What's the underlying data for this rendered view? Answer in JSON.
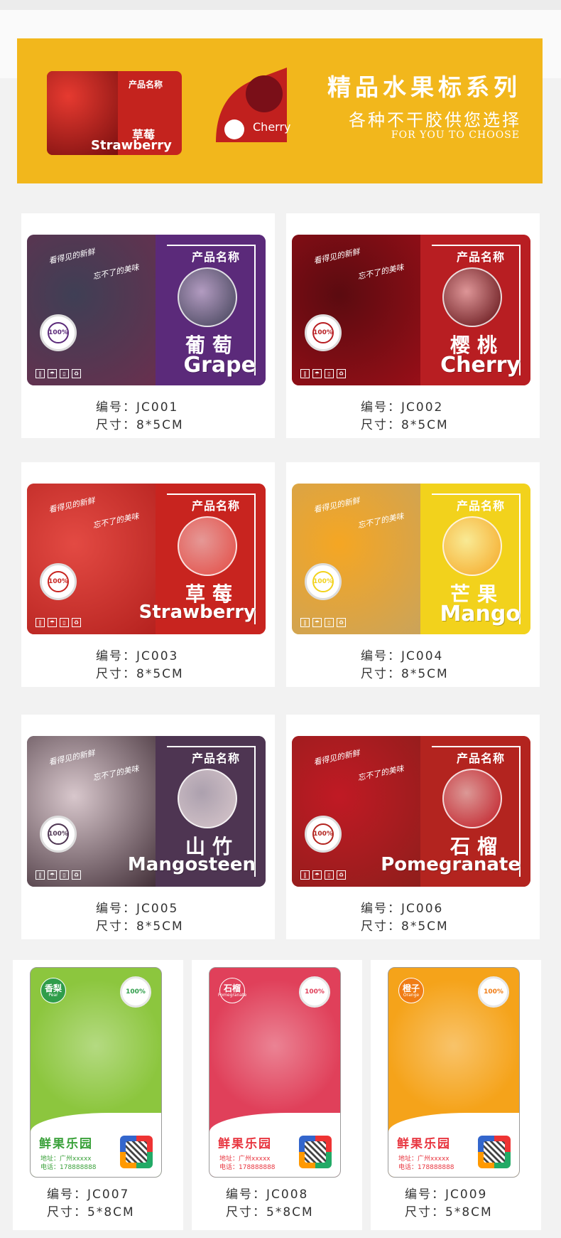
{
  "banner": {
    "title": "精品水果标系列",
    "subtitle": "各种不干胶供您选择",
    "english": "FOR YOU TO CHOOSE",
    "mini1": {
      "label": "产品名称",
      "cn": "草莓",
      "en": "Strawberry"
    },
    "mini2": {
      "en": "Cherry"
    }
  },
  "common": {
    "product_label": "产品名称",
    "badge": "100%",
    "slogan1": "看得见的新鲜",
    "slogan2": "忘不了的美味",
    "code_prefix": "编号：",
    "size_prefix": "尺寸："
  },
  "labels": [
    {
      "cn": "葡萄",
      "en": "Grape",
      "code": "JC001",
      "size": "8*5CM",
      "panel": "#5b2a7a",
      "photo": "#6a2f4e",
      "circle": "#3f3f55"
    },
    {
      "cn": "樱桃",
      "en": "Cherry",
      "code": "JC002",
      "size": "8*5CM",
      "panel": "#b81e22",
      "photo": "#9a0f18",
      "circle": "#5b0b10"
    },
    {
      "cn": "草莓",
      "en": "Strawberry",
      "code": "JC003",
      "size": "8*5CM",
      "panel": "#c8241f",
      "photo": "#b3201d",
      "circle": "#e34a43"
    },
    {
      "cn": "芒果",
      "en": "Mango",
      "code": "JC004",
      "size": "8*5CM",
      "panel": "#f2d21c",
      "photo": "#c9a35c",
      "circle": "#f5a623"
    },
    {
      "cn": "山竹",
      "en": "Mangosteen",
      "code": "JC005",
      "size": "8*5CM",
      "panel": "#4e3552",
      "photo": "#3d2a33",
      "circle": "#d8c7cc"
    },
    {
      "cn": "石榴",
      "en": "Pomegranate",
      "code": "JC006",
      "size": "8*5CM",
      "panel": "#b3241f",
      "photo": "#8d1e1b",
      "circle": "#c01a24"
    }
  ],
  "vlabels": [
    {
      "tag": "香梨",
      "tag_en": "Pear",
      "brand": "鲜果乐园",
      "addr": "地址：广州xxxxx",
      "tel": "电话：178888888",
      "code": "JC007",
      "size": "5*8CM",
      "bg": "#8cc63e",
      "tagbg": "#2f9d4a"
    },
    {
      "tag": "石榴",
      "tag_en": "Pomegranate",
      "brand": "鲜果乐园",
      "addr": "地址：广州xxxxx",
      "tel": "电话：178888888",
      "code": "JC008",
      "size": "5*8CM",
      "bg": "#e0405a",
      "tagbg": "#e0405a"
    },
    {
      "tag": "橙子",
      "tag_en": "Orange",
      "brand": "鲜果乐园",
      "addr": "地址：广州xxxxx",
      "tel": "电话：178888888",
      "code": "JC009",
      "size": "5*8CM",
      "bg": "#f5a31a",
      "tagbg": "#f07d16"
    }
  ]
}
